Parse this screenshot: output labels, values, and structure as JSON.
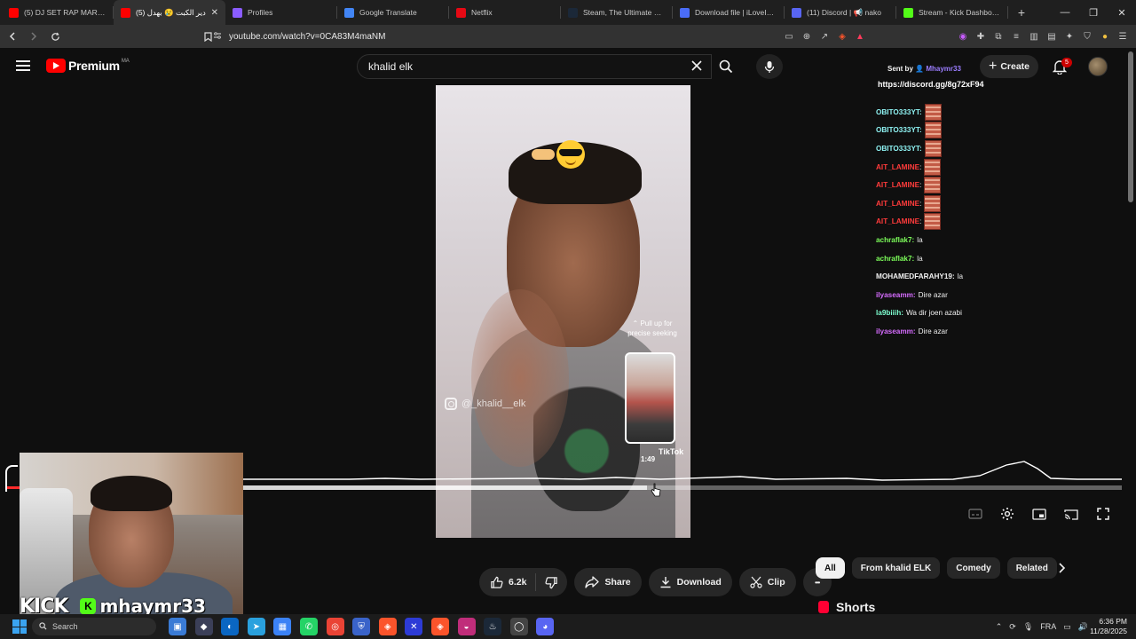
{
  "browser": {
    "tabs": [
      {
        "label": "(5) DJ SET RAP MAROCAIN",
        "color": "#ff0000",
        "active": false
      },
      {
        "label": "(5) دير الكبت 😢 بهدل",
        "color": "#ff0000",
        "active": true
      },
      {
        "label": "Profiles",
        "color": "#8a5cff",
        "active": false
      },
      {
        "label": "Google Translate",
        "color": "#4285f4",
        "active": false
      },
      {
        "label": "Netflix",
        "color": "#e50914",
        "active": false
      },
      {
        "label": "Steam, The Ultimate Onlin",
        "color": "#1b2838",
        "active": false
      },
      {
        "label": "Download file | iLoveIMG",
        "color": "#4a6cf7",
        "active": false
      },
      {
        "label": "(11) Discord | 📢 nako",
        "color": "#5865f2",
        "active": false
      },
      {
        "label": "Stream - Kick Dashboard",
        "color": "#53fc18",
        "active": false
      }
    ],
    "url": "youtube.com/watch?v=0CA83M4maNM",
    "new_tab_glyph": "+",
    "window_controls": [
      "—",
      "❐",
      "✕"
    ]
  },
  "youtube": {
    "logo_text": "Premium",
    "country_code": "MA",
    "search_value": "khalid elk",
    "create_label": "Create",
    "notification_count": "5"
  },
  "overlay": {
    "sent_by_prefix": "Sent by",
    "sent_by_user": "Mhaymr33",
    "discord_link": "https://discord.gg/8g72xF94"
  },
  "chat": [
    {
      "user": "OBITO333YT:",
      "color": "#8ff3f3",
      "message": "",
      "emote": true
    },
    {
      "user": "OBITO333YT:",
      "color": "#8ff3f3",
      "message": "",
      "emote": true
    },
    {
      "user": "OBITO333YT:",
      "color": "#8ff3f3",
      "message": "",
      "emote": true
    },
    {
      "user": "AIT_LAMINE",
      "color": "#ff3b3b",
      "message": ":",
      "emote": true
    },
    {
      "user": "AIT_LAMINE",
      "color": "#ff3b3b",
      "message": ":",
      "emote": true
    },
    {
      "user": "AIT_LAMINE",
      "color": "#ff3b3b",
      "message": ":",
      "emote": true
    },
    {
      "user": "AIT_LAMINE",
      "color": "#ff3b3b",
      "message": ":",
      "emote": true
    },
    {
      "user": "achraflak7:",
      "color": "#7dff5a",
      "message": "la",
      "emote": false
    },
    {
      "user": "achraflak7:",
      "color": "#7dff5a",
      "message": "la",
      "emote": false
    },
    {
      "user": "MOHAMEDFARAHY19:",
      "color": "#f1f1f1",
      "message": "la",
      "emote": false
    },
    {
      "user": "ilyaseamm:",
      "color": "#d66cff",
      "message": "Dire azar",
      "emote": false
    },
    {
      "user": "la9biiih:",
      "color": "#7dffd0",
      "message": "Wa dir joen azabi",
      "emote": false
    },
    {
      "user": "ilyaseamm:",
      "color": "#d66cff",
      "message": "Dire azar",
      "emote": false
    }
  ],
  "video": {
    "instagram_handle": "@_khalid__elk",
    "pull_up_hint": "⌃ Pull up for precise seeking",
    "preview_time": "1:49",
    "tiktok_label": "TikTok",
    "progress_fraction": 0.46
  },
  "actions": {
    "like_count": "6.2k",
    "share_label": "Share",
    "download_label": "Download",
    "clip_label": "Clip",
    "more_glyph": "•••"
  },
  "filters": [
    {
      "label": "All",
      "active": true
    },
    {
      "label": "From khalid ELK",
      "active": false
    },
    {
      "label": "Comedy",
      "active": false
    },
    {
      "label": "Related",
      "active": false
    }
  ],
  "shorts_heading": "Shorts",
  "stream": {
    "kick_logo": "KICK",
    "streamer": "mhaymr33"
  },
  "taskbar": {
    "search_label": "Search",
    "language": "FRA",
    "time": "6:36 PM",
    "date": "11/28/2025"
  }
}
